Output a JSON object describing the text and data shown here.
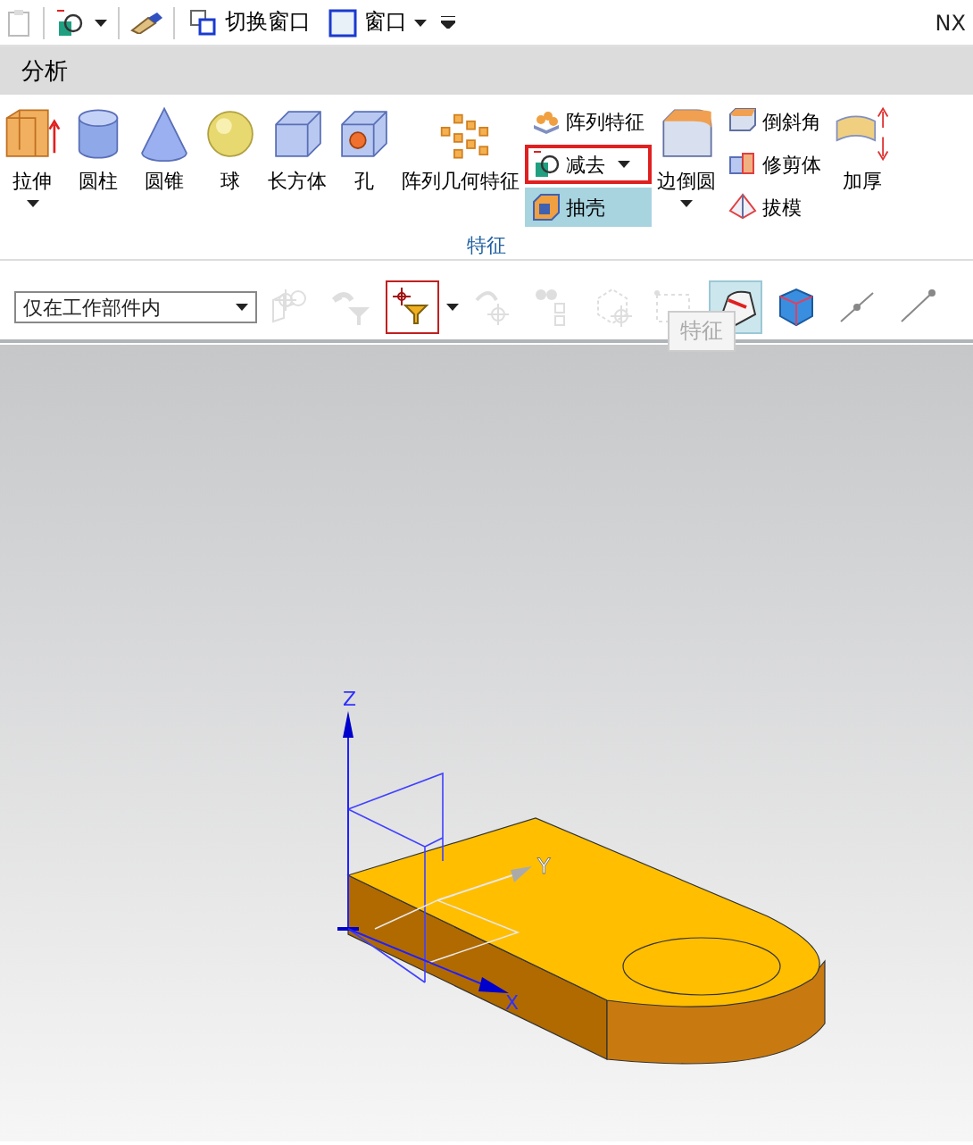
{
  "quick_access": {
    "buttons": [
      {
        "label": "切换窗口",
        "kind": "switch"
      },
      {
        "label": "窗口",
        "kind": "window"
      }
    ],
    "app_title": "NX"
  },
  "tabs": [
    {
      "label": "分析",
      "selected": false
    }
  ],
  "ribbon": {
    "items": [
      {
        "kind": "large",
        "label": "拉伸",
        "dropdown": true
      },
      {
        "kind": "large",
        "label": "圆柱"
      },
      {
        "kind": "large",
        "label": "圆锥"
      },
      {
        "kind": "large",
        "label": "球"
      },
      {
        "kind": "large",
        "label": "长方体"
      },
      {
        "kind": "large",
        "label": "孔"
      },
      {
        "kind": "large",
        "label": "阵列几何特征"
      },
      {
        "kind": "stack",
        "entries": [
          {
            "label": "阵列特征",
            "marked": false,
            "highlighted": false
          },
          {
            "label": "减去",
            "dropdown": true,
            "marked": true,
            "highlighted": false
          },
          {
            "label": "抽壳",
            "marked": false,
            "highlighted": true
          }
        ]
      },
      {
        "kind": "large",
        "label": "边倒圆",
        "dropdown": true
      },
      {
        "kind": "stack",
        "entries": [
          {
            "label": "倒斜角",
            "marked": false,
            "highlighted": false
          },
          {
            "label": "修剪体",
            "marked": false,
            "highlighted": false
          },
          {
            "label": "拔模",
            "marked": false,
            "highlighted": false
          }
        ]
      },
      {
        "kind": "large",
        "label": "加厚"
      }
    ],
    "group_label": "特征"
  },
  "selection_bar": {
    "filter": {
      "value": "仅在工作部件内"
    },
    "tools": [
      {
        "kind": "assembly",
        "disabled": true,
        "selected": false,
        "outlined": false
      },
      {
        "kind": "filter-arrow",
        "disabled": true,
        "selected": false,
        "outlined": false
      },
      {
        "kind": "snap-filter",
        "disabled": false,
        "selected": false,
        "outlined": true
      },
      {
        "kind": "undo-point",
        "disabled": true,
        "selected": false,
        "outlined": false
      },
      {
        "kind": "chain",
        "disabled": true,
        "selected": false,
        "outlined": false
      },
      {
        "kind": "box-point",
        "disabled": true,
        "selected": false,
        "outlined": false
      },
      {
        "kind": "rect-select",
        "disabled": true,
        "selected": false,
        "outlined": false
      },
      {
        "kind": "shaded",
        "disabled": false,
        "selected": true,
        "outlined": false
      },
      {
        "kind": "cube",
        "disabled": false,
        "selected": false,
        "outlined": false
      },
      {
        "kind": "line-point",
        "disabled": false,
        "selected": false,
        "outlined": false
      },
      {
        "kind": "line-end",
        "disabled": false,
        "selected": false,
        "outlined": false
      }
    ],
    "tooltip": "特征"
  },
  "viewport": {
    "axes": [
      {
        "kind": "z",
        "label": "Z"
      },
      {
        "kind": "y",
        "label": "Y"
      },
      {
        "kind": "x",
        "label": "X"
      }
    ]
  }
}
